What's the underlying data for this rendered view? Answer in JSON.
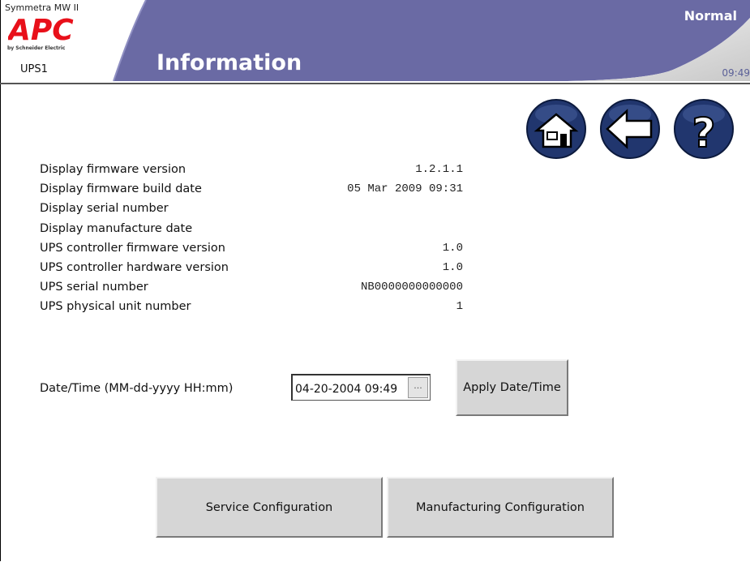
{
  "header": {
    "series": "Symmetra MW II",
    "brand": "APC",
    "brand_tagline": "by Schneider Electric",
    "ups_name": "UPS1",
    "title": "Information",
    "status": "Normal",
    "clock": "09:49"
  },
  "colors": {
    "header_bar": "#6a6aa4",
    "logo_red": "#e8101a",
    "nav_button": "#21366e",
    "button_face": "#d6d6d6"
  },
  "nav": {
    "home_icon": "home-icon",
    "back_icon": "back-arrow-icon",
    "help_icon": "help-icon"
  },
  "info": {
    "rows": [
      {
        "label": "Display firmware version",
        "value": "1.2.1.1"
      },
      {
        "label": "Display firmware build date",
        "value": "05 Mar 2009 09:31"
      },
      {
        "label": "Display serial number",
        "value": ""
      },
      {
        "label": "Display manufacture date",
        "value": ""
      },
      {
        "label": "UPS controller firmware version",
        "value": "1.0"
      },
      {
        "label": "UPS controller hardware version",
        "value": "1.0"
      },
      {
        "label": "UPS serial number",
        "value": "NB0000000000000"
      },
      {
        "label": "UPS physical unit number",
        "value": "1"
      }
    ]
  },
  "datetime": {
    "label": "Date/Time (MM-dd-yyyy HH:mm)",
    "value": "04-20-2004 09:49",
    "picker_label": "...",
    "apply_label": "Apply Date/Time"
  },
  "actions": {
    "service_label": "Service Configuration",
    "manufacturing_label": "Manufacturing Configuration"
  }
}
